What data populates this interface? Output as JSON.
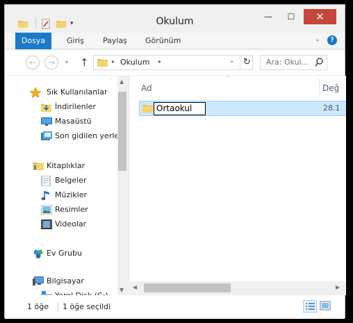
{
  "window": {
    "title": "Okulum",
    "minimize_glyph": "—",
    "maximize_glyph": "☐",
    "close_glyph": "✕"
  },
  "quick_access": {
    "dropdown_glyph": "▾"
  },
  "ribbon": {
    "tabs": [
      {
        "label": "Dosya"
      },
      {
        "label": "Giriş"
      },
      {
        "label": "Paylaş"
      },
      {
        "label": "Görünüm"
      }
    ],
    "expand_glyph": "⌄",
    "help_glyph": "?"
  },
  "nav": {
    "back_glyph": "←",
    "forward_glyph": "→",
    "recent_glyph": "▾",
    "up_glyph": "↑",
    "address": {
      "path_label": "Okulum",
      "separator_glyph": "▸",
      "dropdown_glyph": "⌄",
      "refresh_glyph": "↻"
    },
    "search": {
      "placeholder": "Ara: Okul..."
    }
  },
  "nav_pane": {
    "items": [
      {
        "label": "Sık Kullanılanlar",
        "icon": "star-icon"
      },
      {
        "label": "İndirilenler",
        "icon": "downloads-icon"
      },
      {
        "label": "Masaüstü",
        "icon": "desktop-icon"
      },
      {
        "label": "Son gidilen yerler",
        "icon": "recent-places-icon"
      },
      {
        "label": "Kitaplıklar",
        "icon": "libraries-icon"
      },
      {
        "label": "Belgeler",
        "icon": "documents-icon"
      },
      {
        "label": "Müzikler",
        "icon": "music-icon"
      },
      {
        "label": "Resimler",
        "icon": "pictures-icon"
      },
      {
        "label": "Videolar",
        "icon": "videos-icon"
      },
      {
        "label": "Ev Grubu",
        "icon": "homegroup-icon"
      },
      {
        "label": "Bilgisayar",
        "icon": "computer-icon"
      },
      {
        "label": "Yerel Disk (C:)",
        "icon": "drive-icon"
      }
    ]
  },
  "file_list": {
    "columns": {
      "name": "Ad",
      "date": "Değ"
    },
    "sort_glyph": "^",
    "rows": [
      {
        "name_edit": "Ortaokul",
        "date": "28.1"
      }
    ]
  },
  "status_bar": {
    "count": "1 öğe",
    "selected": "1 öğe seçildi"
  },
  "colors": {
    "accent": "#1979ca",
    "close_button": "#c7463c",
    "selection_fill": "#cce8ff",
    "selection_border": "#99d1ff"
  }
}
